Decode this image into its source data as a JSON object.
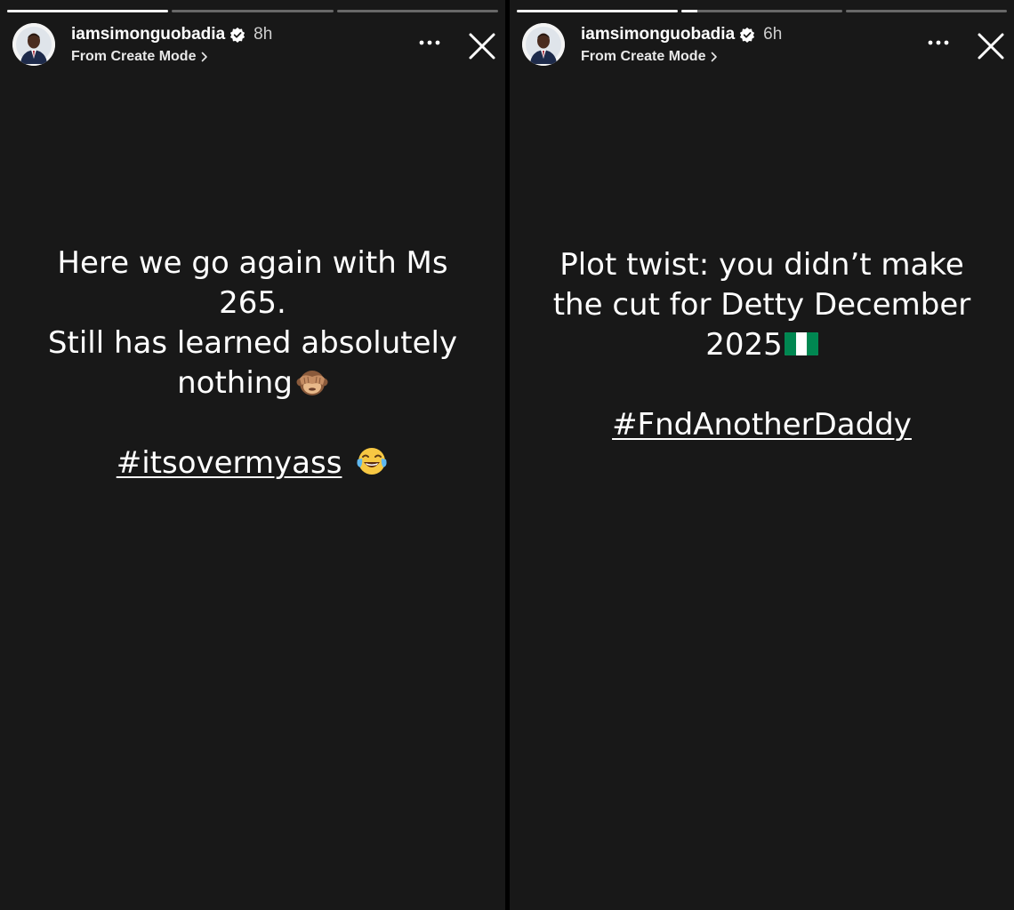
{
  "stories": [
    {
      "username": "iamsimonguobadia",
      "time": "8h",
      "source": "From Create Mode",
      "progress": [
        1,
        0,
        0
      ],
      "caption": {
        "line1": "Here we go again with Ms",
        "line2": "265.",
        "line3": "Still has learned absolutely",
        "line4": "nothing",
        "hashtag": "#itsovermyass"
      },
      "icons": [
        "verified-badge-icon",
        "chevron-right-icon",
        "more-options-icon",
        "close-icon",
        "see-no-evil-monkey-emoji",
        "tears-of-joy-emoji"
      ]
    },
    {
      "username": "iamsimonguobadia",
      "time": "6h",
      "source": "From Create Mode",
      "progress": [
        1,
        0.1,
        0
      ],
      "caption": {
        "line1": "Plot twist: you didn’t make",
        "line2": "the cut for Detty December",
        "line3": "2025",
        "hashtag": "#FndAnotherDaddy"
      },
      "icons": [
        "verified-badge-icon",
        "chevron-right-icon",
        "more-options-icon",
        "close-icon",
        "nigeria-flag-emoji"
      ]
    }
  ],
  "colors": {
    "background": "#181818",
    "text": "#ffffff",
    "progress_track": "rgba(255,255,255,0.35)",
    "progress_fill": "#f2f2f2",
    "verified": "#ffffff",
    "flag_green": "#008751"
  }
}
